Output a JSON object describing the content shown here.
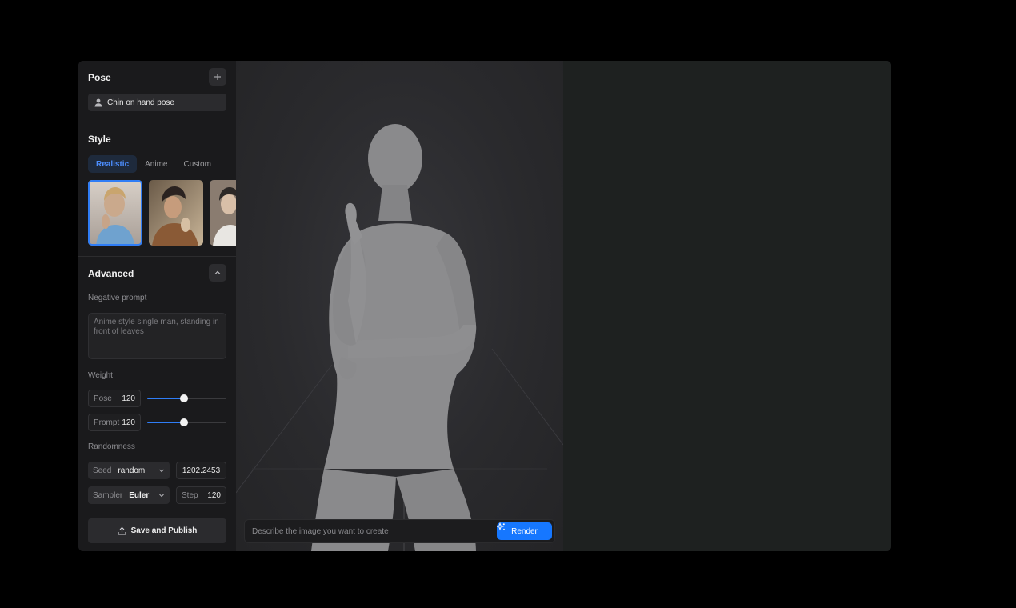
{
  "pose": {
    "title": "Pose",
    "add_icon": "plus-icon",
    "selected_label": "Chin on hand pose",
    "selected_icon": "person-icon"
  },
  "style": {
    "title": "Style",
    "tabs": [
      {
        "label": "Realistic",
        "active": true
      },
      {
        "label": "Anime",
        "active": false
      },
      {
        "label": "Custom",
        "active": false
      }
    ],
    "selected_thumbnail": 0
  },
  "advanced": {
    "title": "Advanced",
    "collapse_icon": "chevron-up-icon",
    "negative_prompt_label": "Negative prompt",
    "negative_prompt_value": "Anime style single man, standing in front of leaves",
    "weight_label": "Weight",
    "weights": [
      {
        "label": "Pose",
        "value": "120",
        "fraction": 0.46
      },
      {
        "label": "Prompt",
        "value": "120",
        "fraction": 0.46
      }
    ],
    "randomness_label": "Randomness",
    "seed": {
      "label": "Seed",
      "value": "random",
      "number": "1202.2453"
    },
    "sampler": {
      "label": "Sampler",
      "value": "Euler"
    },
    "step": {
      "label": "Step",
      "value": "120"
    }
  },
  "actions": {
    "publish_label": "Save and Publish",
    "publish_icon": "upload-icon"
  },
  "prompt": {
    "placeholder": "Describe the image you want to create",
    "render_label": "Render",
    "render_icon": "sparkle-icon"
  },
  "colors": {
    "accent": "#1677ff",
    "sidebar_bg": "#1a1a1c",
    "output_bg": "#1e2120"
  }
}
